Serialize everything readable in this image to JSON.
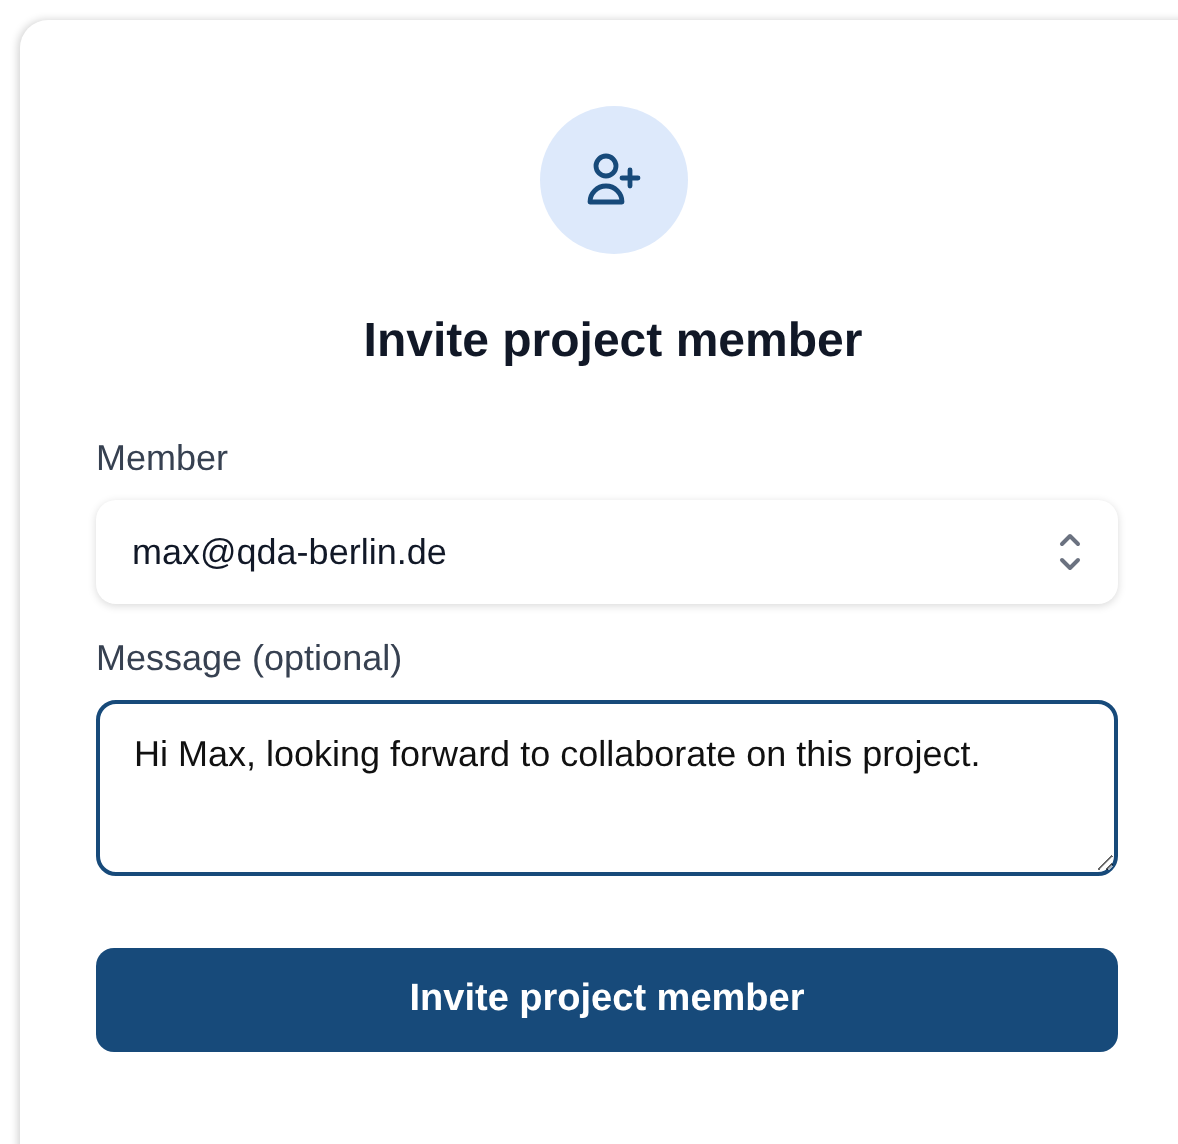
{
  "dialog": {
    "title": "Invite project member",
    "member": {
      "label": "Member",
      "value": "max@qda-berlin.de"
    },
    "message": {
      "label": "Message (optional)",
      "value": "Hi Max, looking forward to collaborate on this project.",
      "focused": true
    },
    "submit_button": "Invite project member"
  }
}
